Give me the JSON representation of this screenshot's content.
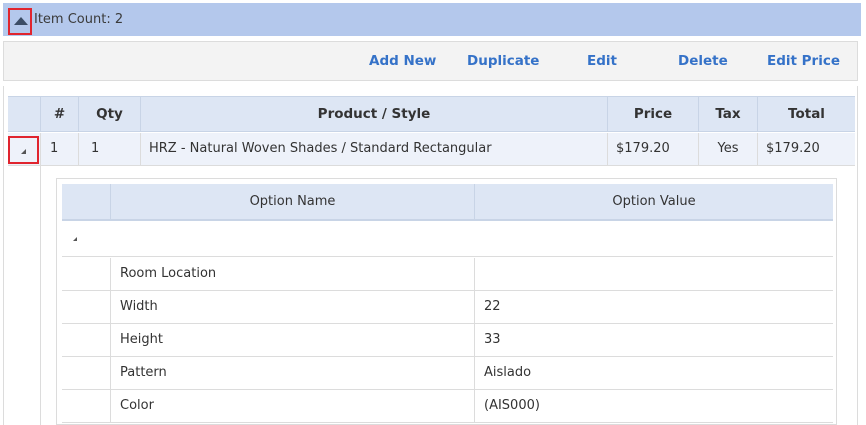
{
  "header": {
    "item_count": "Item Count: 2"
  },
  "toolbar": {
    "add_new": "Add New",
    "duplicate": "Duplicate",
    "edit": "Edit",
    "delete": "Delete",
    "edit_price": "Edit Price"
  },
  "grid": {
    "columns": {
      "num": "#",
      "qty": "Qty",
      "product": "Product / Style",
      "price": "Price",
      "tax": "Tax",
      "total": "Total"
    },
    "rows": [
      {
        "num": "1",
        "qty": "1",
        "product": "HRZ - Natural Woven Shades / Standard Rectangular",
        "price": "$179.20",
        "tax": "Yes",
        "total": "$179.20"
      }
    ]
  },
  "options": {
    "columns": {
      "name": "Option Name",
      "value": "Option Value"
    },
    "rows": [
      {
        "name": "Room Location",
        "value": ""
      },
      {
        "name": "Width",
        "value": "22"
      },
      {
        "name": "Height",
        "value": "33"
      },
      {
        "name": "Pattern",
        "value": "Aislado"
      },
      {
        "name": "Color",
        "value": "(AIS000)"
      }
    ]
  },
  "colors": {
    "header_bar": "#b4c8ec",
    "link": "#3572c8",
    "highlight_border": "#e0242e"
  }
}
